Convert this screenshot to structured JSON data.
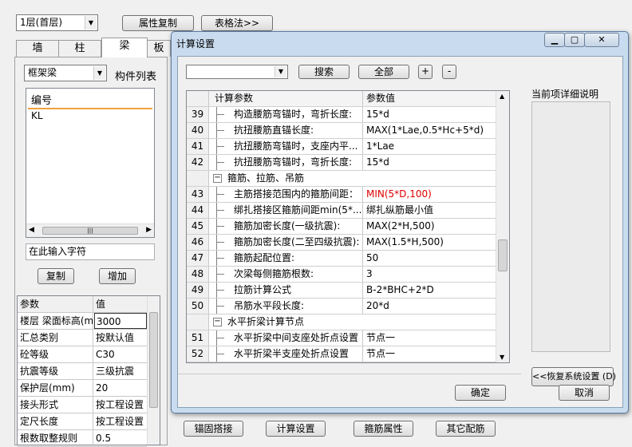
{
  "toolbar": {
    "floor_select": "1层(首层)",
    "attr_copy": "属性复制",
    "table_method": "表格法>>"
  },
  "left": {
    "tabs": [
      "墙",
      "柱",
      "梁",
      "板"
    ],
    "member_type": "框架梁",
    "member_list_label": "构件列表",
    "list_header": "编号",
    "list_items": [
      "KL"
    ],
    "search_placeholder": "在此输入字符",
    "copy_btn": "复制",
    "add_btn": "增加",
    "props_header": [
      "参数",
      "值"
    ],
    "props": [
      {
        "k": "楼层 梁面标高(m",
        "v": "3000"
      },
      {
        "k": "汇总类别",
        "v": "按默认值"
      },
      {
        "k": "砼等级",
        "v": "C30"
      },
      {
        "k": "抗震等级",
        "v": "三级抗震"
      },
      {
        "k": "保护层(mm)",
        "v": "20"
      },
      {
        "k": "接头形式",
        "v": "按工程设置"
      },
      {
        "k": "定尺长度",
        "v": "按工程设置"
      },
      {
        "k": "根数取整规则",
        "v": "0.5"
      }
    ]
  },
  "bottom_buttons": [
    "锚固搭接",
    "计算设置",
    "箍筋属性",
    "其它配筋"
  ],
  "dialog": {
    "title": "计算设置",
    "search_btn": "搜索",
    "all_btn": "全部",
    "plus_btn": "+",
    "minus_btn": "-",
    "col_param": "计算参数",
    "col_value": "参数值",
    "rows": [
      {
        "n": "39",
        "k": "构造腰筋弯锚时，弯折长度:",
        "v": "15*d",
        "type": "item"
      },
      {
        "n": "40",
        "k": "抗扭腰筋直锚长度:",
        "v": "MAX(1*Lae,0.5*Hc+5*d)",
        "type": "item"
      },
      {
        "n": "41",
        "k": "抗扭腰筋弯锚时，支座内平...",
        "v": "1*Lae",
        "type": "item"
      },
      {
        "n": "42",
        "k": "抗扭腰筋弯锚时，弯折长度:",
        "v": "15*d",
        "type": "item"
      },
      {
        "n": "",
        "k": "箍筋、拉筋、吊筋",
        "v": "",
        "type": "group"
      },
      {
        "n": "43",
        "k": "主筋搭接范围内的箍筋间距：",
        "v": "MIN(5*D,100)",
        "type": "item",
        "red": true
      },
      {
        "n": "44",
        "k": "绑扎搭接区箍筋间距min(5*...",
        "v": "绑扎纵筋最小值",
        "type": "item"
      },
      {
        "n": "45",
        "k": "箍筋加密长度(一级抗震):",
        "v": "MAX(2*H,500)",
        "type": "item"
      },
      {
        "n": "46",
        "k": "箍筋加密长度(二至四级抗震):",
        "v": "MAX(1.5*H,500)",
        "type": "item"
      },
      {
        "n": "47",
        "k": "箍筋起配位置:",
        "v": "50",
        "type": "item"
      },
      {
        "n": "48",
        "k": "次梁每侧箍筋根数:",
        "v": "3",
        "type": "item"
      },
      {
        "n": "49",
        "k": "拉筋计算公式",
        "v": "B-2*BHC+2*D",
        "type": "item"
      },
      {
        "n": "50",
        "k": "吊筋水平段长度:",
        "v": "20*d",
        "type": "item"
      },
      {
        "n": "",
        "k": "水平折梁计算节点",
        "v": "",
        "type": "group"
      },
      {
        "n": "51",
        "k": "水平折梁中间支座处折点设置",
        "v": "节点一",
        "type": "item"
      },
      {
        "n": "52",
        "k": "水平折梁半支座处折点设置",
        "v": "节点一",
        "type": "item"
      }
    ],
    "detail_label": "当前项详细说明",
    "restore_btn": "<<恢复系统设置 (D)",
    "ok_btn": "确定",
    "cancel_btn": "取消"
  }
}
